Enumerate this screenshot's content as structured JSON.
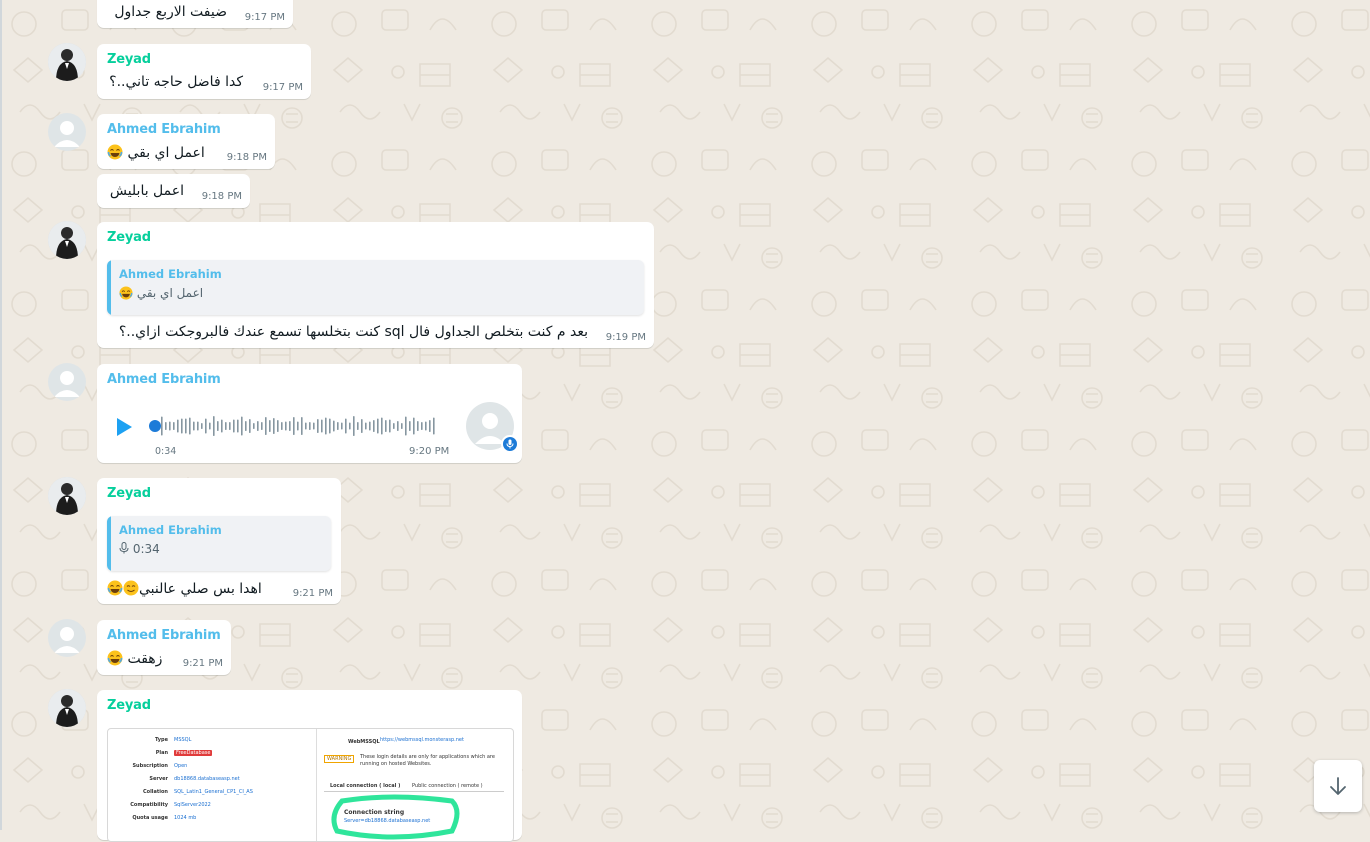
{
  "messages": [
    {
      "id": "m1",
      "sender": "",
      "text": "ضيفت الاربع جداول",
      "time": "9:17 PM"
    },
    {
      "id": "m2",
      "sender": "Zeyad",
      "text": "كدا فاضل حاجه تاني..؟",
      "time": "9:17 PM"
    },
    {
      "id": "m3",
      "sender": "Ahmed Ebrahim",
      "text": "اعمل اي بقي",
      "emoji": "joy",
      "time": "9:18 PM"
    },
    {
      "id": "m4",
      "sender": "",
      "text": "اعمل بابليش",
      "time": "9:18 PM"
    },
    {
      "id": "m5",
      "sender": "Zeyad",
      "quote": {
        "sender": "Ahmed Ebrahim",
        "text": "اعمل اي بقي",
        "emoji": "joy"
      },
      "text": "بعد م كنت بتخلص الجداول فال sql كنت بتخلسها تسمع عندك فالبروجكت ازاي..؟",
      "time": "9:19 PM"
    },
    {
      "id": "m6",
      "sender": "Ahmed Ebrahim",
      "voice": {
        "duration": "0:34",
        "progress": 0.0
      },
      "time": "9:20 PM"
    },
    {
      "id": "m7",
      "sender": "Zeyad",
      "quote": {
        "sender": "Ahmed Ebrahim",
        "text": "0:34",
        "icon": "mic-icon"
      },
      "text": "اهدا بس صلي عالنبي",
      "emoji": "joy,smile",
      "time": "9:21 PM"
    },
    {
      "id": "m8",
      "sender": "Ahmed Ebrahim",
      "text": "زهقت",
      "emoji": "joy",
      "time": "9:21 PM"
    },
    {
      "id": "m9",
      "sender": "Zeyad",
      "image": {
        "left_rows": [
          {
            "label": "Type",
            "value": "MSSQL"
          },
          {
            "label": "Plan",
            "value": "FreeDatabase"
          },
          {
            "label": "Subscription",
            "value": "Open"
          },
          {
            "label": "Server",
            "value": "db18868.databaseasp.net"
          },
          {
            "label": "Collation",
            "value": "SQL_Latin1_General_CP1_CI_AS"
          },
          {
            "label": "Compatibility",
            "value": "SqlServer2022"
          },
          {
            "label": "Quota usage",
            "value": "1024 mb"
          }
        ],
        "right_title": "WebMSSQL",
        "right_link": "https://webmssql.monsterasp.net",
        "warning_label": "WARNING",
        "warning_text": "These login details are only for applications which are running on hosted Websites.",
        "tab_local": "Local connection ( local )",
        "tab_public": "Public connection ( remote )",
        "connection_title": "Connection string",
        "connection_text": "Server=db18868.databaseasp.net"
      }
    }
  ],
  "colors": {
    "zeyad": "#06cf9c",
    "ahmed": "#53bdeb",
    "bubble": "#ffffff",
    "background": "#efeae2"
  },
  "icons": {
    "scroll_down": "arrow-down-icon",
    "play": "play-icon",
    "mic": "mic-icon"
  }
}
